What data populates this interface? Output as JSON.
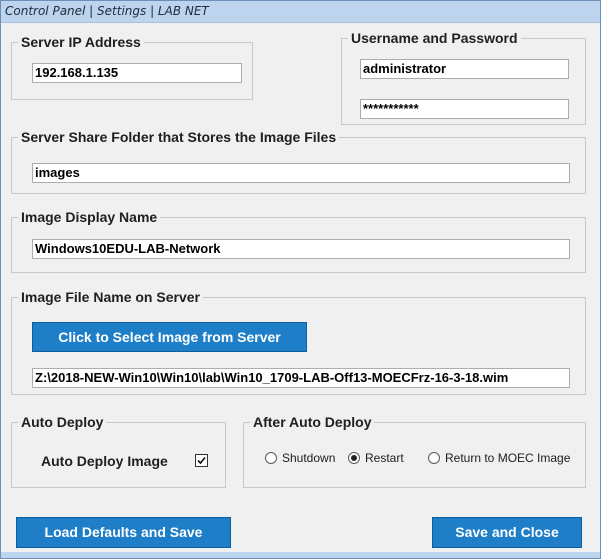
{
  "window": {
    "title": "Control Panel | Settings | LAB NET"
  },
  "server_ip": {
    "legend": "Server IP Address",
    "value": "192.168.1.135"
  },
  "credentials": {
    "legend": "Username and Password",
    "username": "administrator",
    "password": "***********"
  },
  "share_folder": {
    "legend": "Server Share Folder that Stores the Image Files",
    "value": "images"
  },
  "display_name": {
    "legend": "Image Display Name",
    "value": "Windows10EDU-LAB-Network"
  },
  "image_file": {
    "legend": "Image File Name on Server",
    "select_button": "Click to Select Image from Server",
    "path": "Z:\\2018-NEW-Win10\\Win10\\lab\\Win10_1709-LAB-Off13-MOECFrz-16-3-18.wim"
  },
  "auto_deploy": {
    "legend": "Auto Deploy",
    "checkbox_label": "Auto Deploy Image",
    "checked": true
  },
  "after_deploy": {
    "legend": "After Auto Deploy",
    "options": [
      {
        "label": "Shutdown",
        "selected": false
      },
      {
        "label": "Restart",
        "selected": true
      },
      {
        "label": "Return to MOEC Image",
        "selected": false
      }
    ]
  },
  "buttons": {
    "load_defaults": "Load Defaults and Save",
    "save_close": "Save and Close"
  },
  "colors": {
    "button_blue": "#1e7ec8",
    "titlebar": "#bcd4ee"
  }
}
